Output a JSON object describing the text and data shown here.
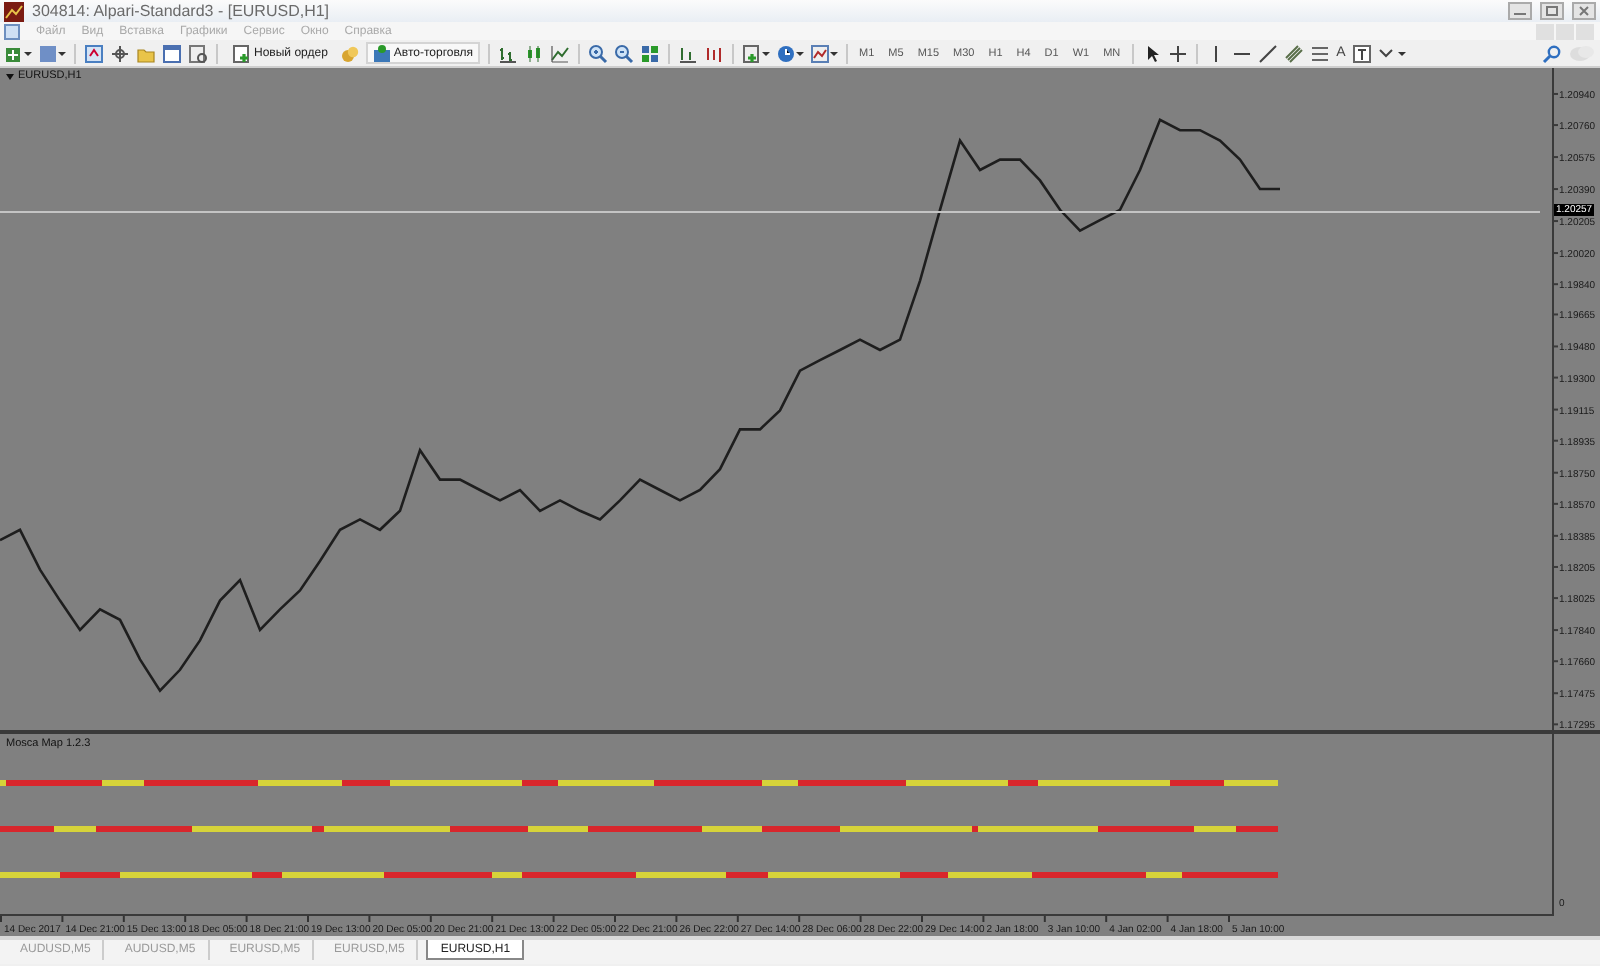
{
  "window": {
    "title": "304814: Alpari-Standard3 - [EURUSD,H1]"
  },
  "menu": [
    "Файл",
    "Вид",
    "Вставка",
    "Графики",
    "Сервис",
    "Окно",
    "Справка"
  ],
  "toolbar": {
    "new_order": "Новый ордер",
    "auto_trading": "Авто-торговля",
    "timeframes": [
      "M1",
      "M5",
      "M15",
      "M30",
      "H1",
      "H4",
      "D1",
      "W1",
      "MN"
    ],
    "text_tool": "A"
  },
  "chart": {
    "chart_data": {
      "type": "line",
      "ylim": [
        1.1621,
        1.2109
      ],
      "series": [
        {
          "name": "EURUSD,H1",
          "color": "#1e1e1e",
          "values": [
            1.1836,
            1.1842,
            1.1819,
            1.1801,
            1.1784,
            1.1796,
            1.179,
            1.1767,
            1.1749,
            1.1761,
            1.1778,
            1.1801,
            1.1813,
            1.1784,
            1.1796,
            1.1807,
            1.1824,
            1.1842,
            1.1848,
            1.1842,
            1.1853,
            1.1888,
            1.1871,
            1.1871,
            1.1865,
            1.1859,
            1.1865,
            1.1853,
            1.1859,
            1.1853,
            1.1848,
            1.1859,
            1.1871,
            1.1865,
            1.1859,
            1.1865,
            1.1877,
            1.19,
            1.19,
            1.1911,
            1.1934,
            1.194,
            1.1946,
            1.1952,
            1.1946,
            1.1952,
            1.1986,
            1.2027,
            1.2067,
            1.205,
            1.2056,
            1.2056,
            1.2044,
            1.2027,
            1.2015,
            1.2021,
            1.2027,
            1.205,
            1.2079,
            1.2073,
            1.2073,
            1.2067,
            1.2056,
            1.2039,
            1.2039
          ]
        },
        {
          "name": "1.20257",
          "color": "#c4c4c4",
          "values": [
            1.20257,
            1.20257,
            1.20257,
            1.20257,
            1.20257,
            1.20257,
            1.20257,
            1.20257,
            1.20257,
            1.20257,
            1.20257,
            1.20257,
            1.20257,
            1.20257,
            1.20257,
            1.20257,
            1.20257,
            1.20257,
            1.20257,
            1.20257,
            1.20257,
            1.20257,
            1.20257,
            1.20257,
            1.20257,
            1.20257,
            1.20257,
            1.20257,
            1.20257,
            1.20257,
            1.20257,
            1.20257,
            1.20257,
            1.20257,
            1.20257,
            1.20257,
            1.20257,
            1.20257,
            1.20257,
            1.20257,
            1.20257,
            1.20257,
            1.20257,
            1.20257,
            1.20257,
            1.20257,
            1.20257,
            1.20257,
            1.20257,
            1.20257,
            1.20257,
            1.20257,
            1.20257,
            1.20257,
            1.20257,
            1.20257,
            1.20257,
            1.20257,
            1.20257,
            1.20257,
            1.20257,
            1.20257,
            1.20257,
            1.20257,
            1.20257,
            1.20257,
            1.20257,
            1.20257,
            1.20257,
            1.20257,
            1.20257,
            1.20257,
            1.20257,
            1.20257,
            1.20257,
            1.20257,
            1.20257,
            1.20257
          ]
        }
      ],
      "yticks": [
        {
          "value": 1.2094,
          "label": "1.20940"
        },
        {
          "value": 1.2076,
          "label": "1.20760"
        },
        {
          "value": 1.20575,
          "label": "1.20575"
        },
        {
          "value": 1.2039,
          "label": "1.20390"
        },
        {
          "value": 1.20205,
          "label": "1.20205"
        },
        {
          "value": 1.2002,
          "label": "1.20020"
        },
        {
          "value": 1.1984,
          "label": "1.19840"
        },
        {
          "value": 1.19665,
          "label": "1.19665"
        },
        {
          "value": 1.1948,
          "label": "1.19480"
        },
        {
          "value": 1.193,
          "label": "1.19300"
        },
        {
          "value": 1.19115,
          "label": "1.19115"
        },
        {
          "value": 1.18935,
          "label": "1.18935"
        },
        {
          "value": 1.1875,
          "label": "1.18750"
        },
        {
          "value": 1.1857,
          "label": "1.18570"
        },
        {
          "value": 1.18385,
          "label": "1.18385"
        },
        {
          "value": 1.18205,
          "label": "1.18205"
        },
        {
          "value": 1.18025,
          "label": "1.18025"
        },
        {
          "value": 1.1784,
          "label": "1.17840"
        },
        {
          "value": 1.1766,
          "label": "1.17660"
        },
        {
          "value": 1.17475,
          "label": "1.17475"
        },
        {
          "value": 1.17295,
          "label": "1.17295"
        }
      ]
    }
  },
  "time_axis": [
    "14 Dec 2017",
    "14 Dec 21:00",
    "15 Dec 13:00",
    "18 Dec 05:00",
    "18 Dec 21:00",
    "19 Dec 13:00",
    "20 Dec 05:00",
    "20 Dec 21:00",
    "21 Dec 13:00",
    "22 Dec 05:00",
    "22 Dec 21:00",
    "26 Dec 22:00",
    "27 Dec 14:00",
    "28 Dec 06:00",
    "28 Dec 22:00",
    "29 Dec 14:00",
    "2 Jan 18:00",
    "3 Jan 10:00",
    "4 Jan 02:00",
    "4 Jan 18:00",
    "5 Jan 10:00"
  ],
  "indicator": {
    "title": "Mosca Map 1.2.3",
    "scale_label": "0"
  },
  "tabs": [
    {
      "label": "AUDUSD,M5",
      "selected": false
    },
    {
      "label": "AUDUSD,M5",
      "selected": false
    },
    {
      "label": "EURUSD,M5",
      "selected": false
    },
    {
      "label": "EURUSD,M5",
      "selected": false
    },
    {
      "label": "EURUSD,H1",
      "selected": true
    }
  ]
}
